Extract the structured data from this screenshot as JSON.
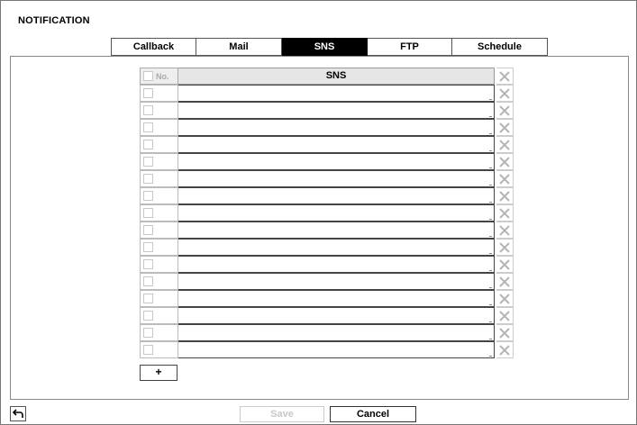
{
  "window": {
    "title": "NOTIFICATION"
  },
  "tabs": [
    {
      "label": "Callback",
      "active": false
    },
    {
      "label": "Mail",
      "active": false
    },
    {
      "label": "SNS",
      "active": true
    },
    {
      "label": "FTP",
      "active": false
    },
    {
      "label": "Schedule",
      "active": false
    }
  ],
  "table": {
    "headers": {
      "no": "No.",
      "main": "SNS"
    },
    "rows": [
      "",
      "",
      "",
      "",
      "",
      "",
      "",
      "",
      "",
      "",
      "",
      "",
      "",
      "",
      "",
      ""
    ]
  },
  "add_button": {
    "label": "+"
  },
  "footer": {
    "save_label": "Save",
    "cancel_label": "Cancel"
  },
  "colors": {
    "active_tab_bg": "#000000",
    "disabled_text": "#c8c8c8"
  }
}
